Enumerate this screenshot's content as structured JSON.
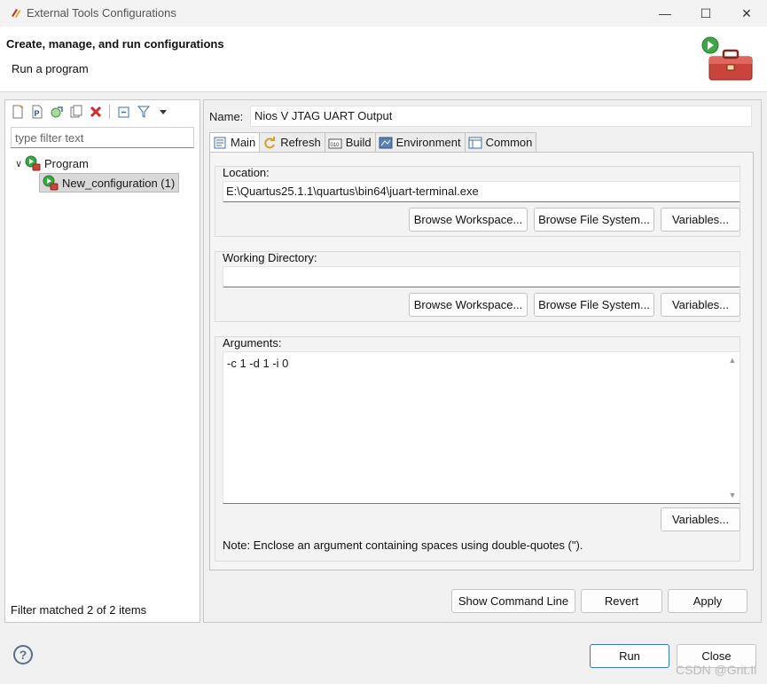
{
  "window": {
    "title": "External Tools Configurations",
    "minimize": "—",
    "maximize": "☐",
    "close": "✕"
  },
  "header": {
    "title": "Create, manage, and run configurations",
    "subtitle": "Run a program"
  },
  "left": {
    "filter_placeholder": "type filter text",
    "tree": [
      {
        "label": "Program"
      },
      {
        "label": "New_configuration (1)"
      }
    ],
    "status": "Filter matched 2 of 2 items"
  },
  "right": {
    "name_label": "Name:",
    "name_value": "Nios V JTAG UART Output",
    "tabs": [
      {
        "label": "Main"
      },
      {
        "label": "Refresh"
      },
      {
        "label": "Build"
      },
      {
        "label": "Environment"
      },
      {
        "label": "Common"
      }
    ],
    "location": {
      "label": "Location:",
      "value": "E:\\Quartus25.1.1\\quartus\\bin64\\juart-terminal.exe",
      "browse_workspace": "Browse Workspace...",
      "browse_fs": "Browse File System...",
      "variables": "Variables..."
    },
    "workdir": {
      "label": "Working Directory:",
      "value": "",
      "browse_workspace": "Browse Workspace...",
      "browse_fs": "Browse File System...",
      "variables": "Variables..."
    },
    "arguments": {
      "label": "Arguments:",
      "value": "-c 1 -d 1 -i 0",
      "variables": "Variables...",
      "note": "Note: Enclose an argument containing spaces using double-quotes (\")."
    },
    "buttons": {
      "show_command_line": "Show Command Line",
      "revert": "Revert",
      "apply": "Apply"
    }
  },
  "footer": {
    "run": "Run",
    "close": "Close",
    "help": "?"
  },
  "watermark": "CSDN @Grit.Il"
}
